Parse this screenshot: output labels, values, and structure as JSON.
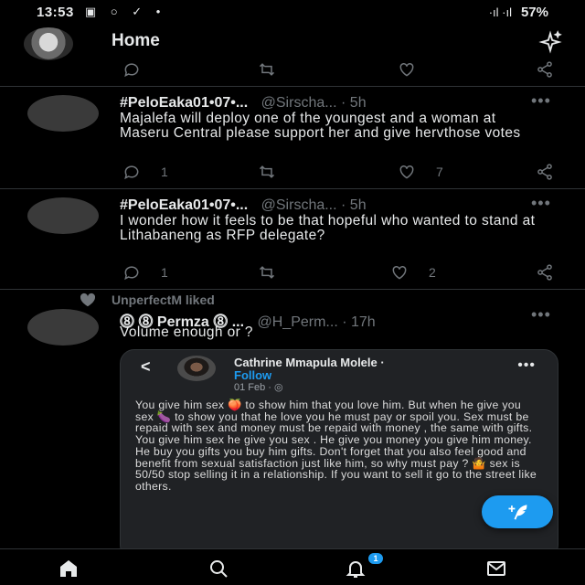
{
  "status_bar": {
    "time": "13:53",
    "left_icons": "▣ ○ ✓ •",
    "signal_text": "·ıl ·ıl",
    "battery": "57%"
  },
  "header": {
    "title": "Home"
  },
  "tweets": [
    {
      "name": "#PeloEaka01•07•...",
      "handle_time": "@Sirscha... · 5h",
      "text": "Majalefa will deploy one of the youngest and a woman at Maseru Central please support her and give hervthose votes",
      "replies": "1",
      "retweets": "",
      "likes": "7"
    },
    {
      "name": "#PeloEaka01•07•...",
      "handle_time": "@Sirscha... · 5h",
      "text": "I wonder how it feels to be that hopeful who wanted to stand at Lithabaneng as RFP delegate?",
      "replies": "1",
      "retweets": "",
      "likes": "2"
    },
    {
      "liked_by": "UnperfectM liked",
      "name": "⓼ ⓼ Permza ⓼ ...",
      "handle_time": "@H_Perm... · 17h",
      "text": "Volume enough or ?"
    }
  ],
  "embed": {
    "back": "<",
    "name": "Cathrine Mmapula Molele ·",
    "follow": "Follow",
    "date": "01 Feb · ◎",
    "more": "•••",
    "body": "You give him sex 🍑 to show him that you love him. But when he give you sex 🍆 to show you that he love you he must pay or spoil you. Sex must be repaid with sex and money must be repaid with money , the same with gifts. You give him sex he give you sex . He give you money you give him money. He buy you gifts you buy him gifts. Don't forget that you also feel good and benefit from sexual satisfaction just like him, so why must pay ? 🤷 sex is 50/50 stop selling it in a relationship. If you want to sell it go to the street like others."
  },
  "nav": {
    "notifications_badge": "1"
  },
  "more_label": "•••",
  "colors": {
    "accent": "#1d9bf0",
    "muted": "#71767b",
    "background": "#000000"
  },
  "icons": [
    "sparkle-icon",
    "reply-icon",
    "retweet-icon",
    "heart-icon",
    "share-icon",
    "home-icon",
    "search-icon",
    "bell-icon",
    "mail-icon",
    "compose-icon"
  ]
}
